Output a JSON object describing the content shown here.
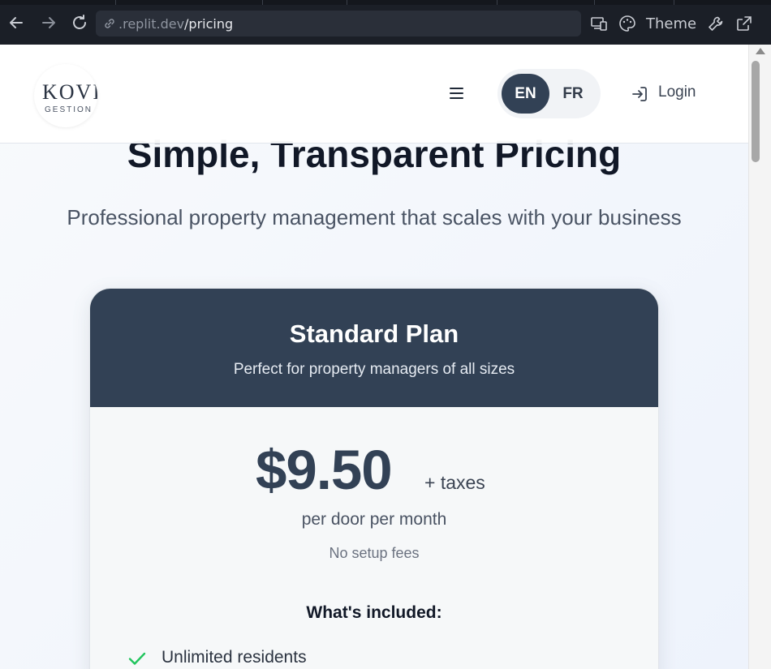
{
  "browser": {
    "url_domain": ".replit.dev",
    "url_path": "/pricing",
    "theme_label": "Theme"
  },
  "header": {
    "logo_main": "KOVI",
    "logo_sub": "GESTION",
    "lang_en": "EN",
    "lang_fr": "FR",
    "active_language": "EN",
    "login_label": "Login"
  },
  "hero": {
    "title": "Simple, Transparent Pricing",
    "subtitle": "Professional property management that scales with your business"
  },
  "plan": {
    "name": "Standard Plan",
    "description": "Perfect for property managers of all sizes",
    "price": "$9.50",
    "tax_note": "+ taxes",
    "unit": "per door per month",
    "setup_note": "No setup fees",
    "included_heading": "What's included:",
    "features": [
      "Unlimited residents"
    ]
  },
  "colors": {
    "brand_dark": "#324155",
    "check_green": "#22c55e"
  }
}
